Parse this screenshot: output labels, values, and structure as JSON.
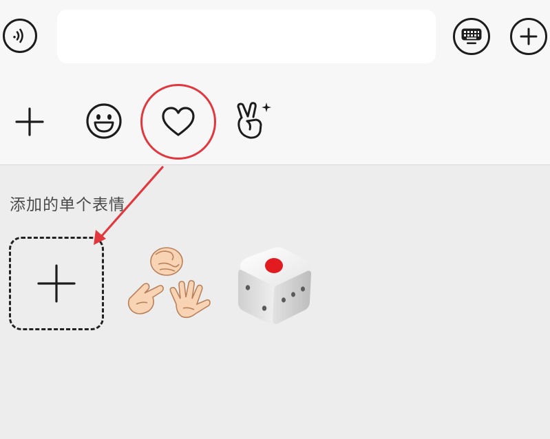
{
  "input_bar": {
    "voice_icon": "voice-wave-icon",
    "text_value": "",
    "keyboard_icon": "keyboard-icon",
    "more_icon": "plus-circle-icon"
  },
  "emoji_tabs": [
    {
      "name": "add",
      "icon": "plus-icon"
    },
    {
      "name": "emoji",
      "icon": "smiley-icon"
    },
    {
      "name": "favorites",
      "icon": "heart-icon",
      "highlighted": true
    },
    {
      "name": "gesture",
      "icon": "victory-hand-sparkle-icon"
    }
  ],
  "favorites_panel": {
    "section_title": "添加的单个表情",
    "items": [
      {
        "type": "add",
        "icon": "plus-icon"
      },
      {
        "type": "sticker",
        "icon": "rock-paper-scissors-icon"
      },
      {
        "type": "sticker",
        "icon": "dice-icon"
      }
    ]
  },
  "colors": {
    "highlight": "#e0383e",
    "icon": "#1c1c1c",
    "panel_background": "#ededed",
    "bar_background": "#f7f7f7"
  }
}
